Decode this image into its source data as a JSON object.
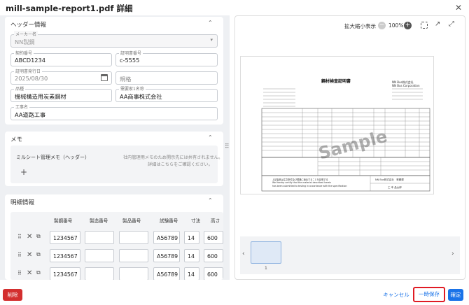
{
  "dialog": {
    "title": "mill-sample-report1.pdf 詳細",
    "close": "✕"
  },
  "header_section": {
    "title": "ヘッダー情報",
    "maker": {
      "label": "メーカー名",
      "value": "NN製鋼"
    },
    "contract_no": {
      "label": "契約番号",
      "value": "ABCD1234"
    },
    "cert_no": {
      "label": "証明書番号",
      "value": "c-5555"
    },
    "issue_date": {
      "label": "証明書発行日",
      "value": "2025/08/30"
    },
    "spec": {
      "placeholder": "規格"
    },
    "product": {
      "label": "品種",
      "value": "機械構造用炭素鋼材"
    },
    "customer": {
      "label": "需要家1名称",
      "value": "AA商事株式会社"
    },
    "project": {
      "label": "工事名",
      "value": "AA道路工事"
    }
  },
  "memo_section": {
    "title": "メモ",
    "memo_label": "ミルシート管理メモ（ヘッダー）",
    "notice_1": "社内管理用メモのため開示先には共有されません。",
    "notice_2": "詳細はこちらをご確認ください。",
    "add": "+"
  },
  "detail_section": {
    "title": "明細情報",
    "columns": [
      "製鋼番号",
      "製造番号",
      "製品番号",
      "試験番号",
      "寸法",
      "高さ"
    ],
    "rows": [
      [
        "1234567",
        "",
        "",
        "A56789",
        "14",
        "600"
      ],
      [
        "1234567",
        "",
        "",
        "A56789",
        "14",
        "600"
      ],
      [
        "1234567",
        "",
        "",
        "A56789",
        "14",
        "600"
      ]
    ]
  },
  "viewer": {
    "zoom_label": "拡大縮小表示",
    "zoom_value": "100%",
    "page_number": "1"
  },
  "doc": {
    "title": "鋼材検査証明書",
    "company_en": "NN Bus Corporation",
    "company_jp": "NN Bus株式会社",
    "company_stamp": "NN Bus株式会社　鉄鋼課",
    "watermark": "Sample",
    "stamp_name": "工 本 品太郎",
    "note_jp": "上記製品は注文条件及び規格に適合することを証明する",
    "note_en_1": "We Hereby certify that the material described herein",
    "note_en_2": "has been submitted to testing in accordance with the specification"
  },
  "footer": {
    "delete": "削除",
    "cancel": "キャンセル",
    "temp_save": "一時保存",
    "confirm": "確定"
  },
  "colors": {
    "accent": "#1a73e8",
    "danger": "#d32f2f",
    "highlight_border": "#e01b24"
  }
}
